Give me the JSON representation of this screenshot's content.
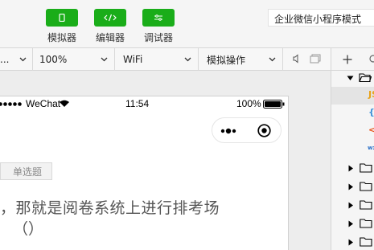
{
  "toolbar": {
    "simulator_label": "模拟器",
    "editor_label": "编辑器",
    "debugger_label": "调试器",
    "mode_value": "企业微信小程序模式",
    "accent": "#1aad19"
  },
  "subbar": {
    "device_value": "...",
    "zoom_value": "100%",
    "network_value": "WiFi",
    "operation_value": "模拟操作"
  },
  "phone": {
    "carrier": "WeChat",
    "time": "11:54",
    "battery": "100%"
  },
  "content": {
    "tag_label": "单选题",
    "question_text": "，那就是阅卷系统上进行排考场",
    "paren_text": "（）"
  },
  "file_tree": {
    "items": [
      {
        "kind": "folder-open"
      },
      {
        "kind": "js",
        "label": "JS"
      },
      {
        "kind": "json",
        "label": "{"
      },
      {
        "kind": "wxml",
        "label": "<"
      },
      {
        "kind": "wxss",
        "label": "wx"
      },
      {
        "kind": "folder"
      },
      {
        "kind": "folder"
      },
      {
        "kind": "folder"
      },
      {
        "kind": "folder"
      },
      {
        "kind": "folder"
      }
    ]
  }
}
